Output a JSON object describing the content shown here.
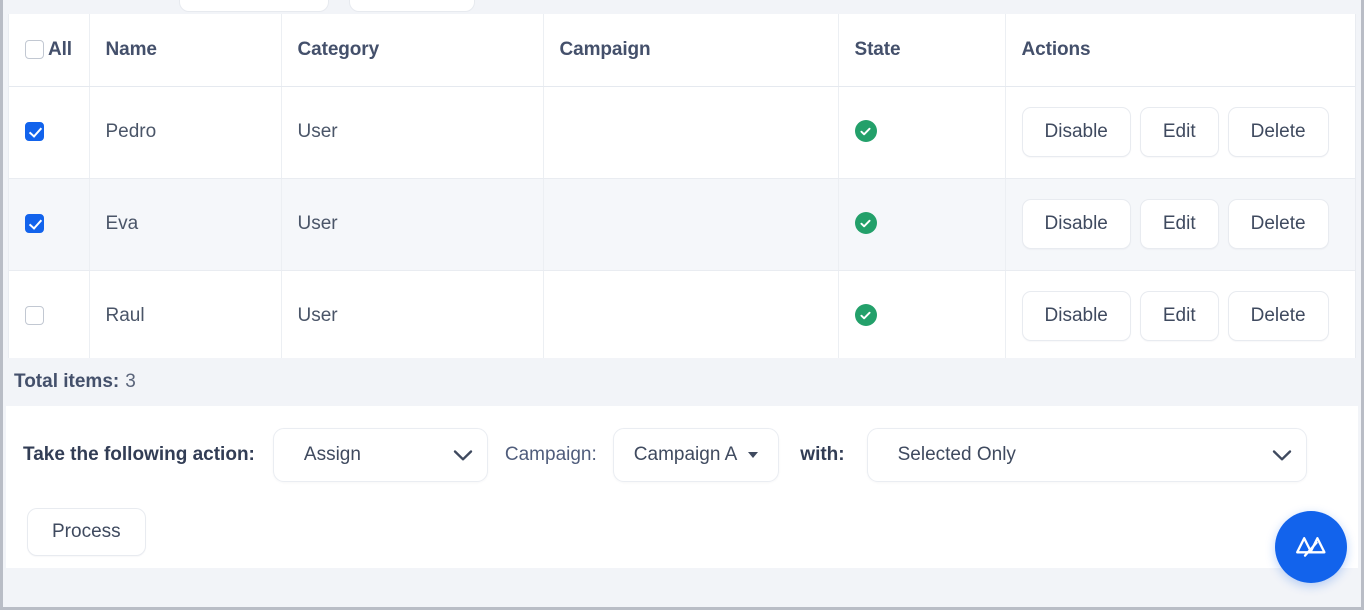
{
  "table": {
    "columns": [
      {
        "key": "select",
        "label": "All"
      },
      {
        "key": "name",
        "label": "Name"
      },
      {
        "key": "category",
        "label": "Category"
      },
      {
        "key": "campaign",
        "label": "Campaign"
      },
      {
        "key": "state",
        "label": "State"
      },
      {
        "key": "actions",
        "label": "Actions"
      }
    ],
    "select_all_checked": false,
    "rows": [
      {
        "selected": true,
        "name": "Pedro",
        "category": "User",
        "campaign": "",
        "state_icon": "check-circle-icon",
        "state_color": "#23a06a",
        "actions": [
          "Disable",
          "Edit",
          "Delete"
        ]
      },
      {
        "selected": true,
        "name": "Eva",
        "category": "User",
        "campaign": "",
        "state_icon": "check-circle-icon",
        "state_color": "#23a06a",
        "actions": [
          "Disable",
          "Edit",
          "Delete"
        ]
      },
      {
        "selected": false,
        "name": "Raul",
        "category": "User",
        "campaign": "",
        "state_icon": "check-circle-icon",
        "state_color": "#23a06a",
        "actions": [
          "Disable",
          "Edit",
          "Delete"
        ]
      }
    ]
  },
  "footer": {
    "total_items_label": "Total items:",
    "total_items_value": "3"
  },
  "bulk_actions": {
    "action_label": "Take the following action:",
    "action_value": "Assign",
    "action_options": [
      "Assign"
    ],
    "campaign_label": "Campaign:",
    "campaign_value": "Campaign A",
    "campaign_options": [
      "Campaign A"
    ],
    "with_label": "with:",
    "scope_value": "Selected Only",
    "scope_options": [
      "Selected Only"
    ],
    "process_label": "Process"
  },
  "fab": {
    "icon": "mountain-logo-icon",
    "color": "#1263ec"
  },
  "colors": {
    "accent": "#1263ec",
    "success": "#23a06a",
    "page_background": "#f2f4f8",
    "card_background": "#ffffff",
    "row_alt_background": "#f5f7fa",
    "header_text": "#44506b",
    "border": "#e9ecf1"
  }
}
